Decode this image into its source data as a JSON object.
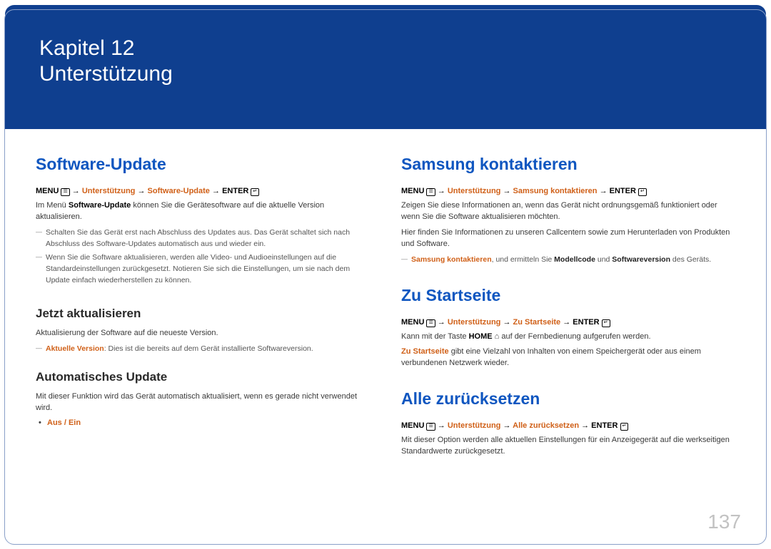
{
  "banner": {
    "chapter_label": "Kapitel 12",
    "chapter_title": "Unterstützung"
  },
  "page_number": "137",
  "nav": {
    "menu": "MENU",
    "arrow": " → ",
    "support": "Unterstützung",
    "enter": "ENTER",
    "menu_glyph": "☰",
    "enter_glyph": "↵"
  },
  "left": {
    "software_update": {
      "title": "Software-Update",
      "path_item": "Software-Update",
      "intro_pre": "Im Menü ",
      "intro_bold": "Software-Update",
      "intro_post": " können Sie die Gerätesoftware auf die aktuelle Version aktualisieren.",
      "notes": [
        "Schalten Sie das Gerät erst nach Abschluss des Updates aus. Das Gerät schaltet sich nach Abschluss des Software-Updates automatisch aus und wieder ein.",
        "Wenn Sie die Software aktualisieren, werden alle Video- und Audioeinstellungen auf die Standardeinstellungen zurückgesetzt. Notieren Sie sich die Einstellungen, um sie nach dem Update einfach wiederherstellen zu können."
      ]
    },
    "update_now": {
      "title": "Jetzt aktualisieren",
      "text": "Aktualisierung der Software auf die neueste Version.",
      "note_hl": "Aktuelle Version",
      "note_rest": ": Dies ist die bereits auf dem Gerät installierte Softwareversion."
    },
    "auto_update": {
      "title": "Automatisches Update",
      "text": "Mit dieser Funktion wird das Gerät automatisch aktualisiert, wenn es gerade nicht verwendet wird.",
      "option": "Aus / Ein"
    }
  },
  "right": {
    "contact": {
      "title": "Samsung kontaktieren",
      "path_item": "Samsung kontaktieren",
      "p1": "Zeigen Sie diese Informationen an, wenn das Gerät nicht ordnungsgemäß funktioniert oder wenn Sie die Software aktualisieren möchten.",
      "p2": "Hier finden Sie Informationen zu unseren Callcentern sowie zum Herunterladen von Produkten und Software.",
      "note_hl1": "Samsung kontaktieren",
      "note_mid1": ", und ermitteln Sie ",
      "note_b1": "Modellcode",
      "note_mid2": " und ",
      "note_b2": "Softwareversion",
      "note_end": " des Geräts."
    },
    "home": {
      "title": "Zu Startseite",
      "path_item": "Zu Startseite",
      "line1_pre": "Kann mit der Taste ",
      "line1_bold": "HOME",
      "line1_glyph": " ⌂ ",
      "line1_post": "auf der Fernbedienung aufgerufen werden.",
      "line2_hl": "Zu Startseite",
      "line2_rest": " gibt eine Vielzahl von Inhalten von einem Speichergerät oder aus einem verbundenen Netzwerk wieder."
    },
    "reset": {
      "title": "Alle zurücksetzen",
      "path_item": "Alle zurücksetzen",
      "text": "Mit dieser Option werden alle aktuellen Einstellungen für ein Anzeigegerät auf die werkseitigen Standardwerte zurückgesetzt."
    }
  }
}
